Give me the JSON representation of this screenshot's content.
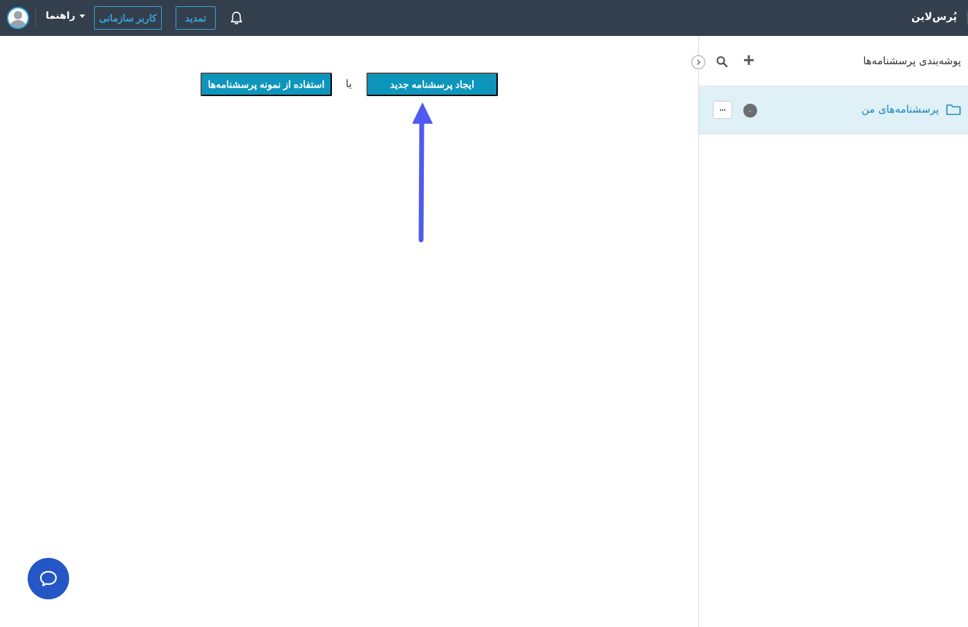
{
  "header": {
    "brand": "پُرس‌لاین",
    "help_label": "راهنما",
    "org_user_label": "کاربر سازمانی",
    "renew_label": "تمدید"
  },
  "sidebar": {
    "title": "پوشه‌بندی پرسشنامه‌ها",
    "folders": [
      {
        "label": "پرسشنامه‌های من",
        "count": "۰",
        "more": "···"
      }
    ]
  },
  "main": {
    "create_label": "ایجاد پرسشنامه جدید",
    "or_label": "یا",
    "template_label": "استفاده از نمونه پرسشنامه‌ها"
  },
  "colors": {
    "topbar": "#343f4d",
    "primary": "#0e95bb",
    "outline_accent": "#3aa3d9",
    "selected_row": "#dff0f7",
    "annotation_arrow": "#4f5bf0",
    "chat": "#2457c5"
  },
  "icons": [
    "bell-icon",
    "avatar-icon",
    "caret-down-icon",
    "plus-icon",
    "search-icon",
    "chevron-right-icon",
    "folder-icon",
    "chat-icon"
  ]
}
